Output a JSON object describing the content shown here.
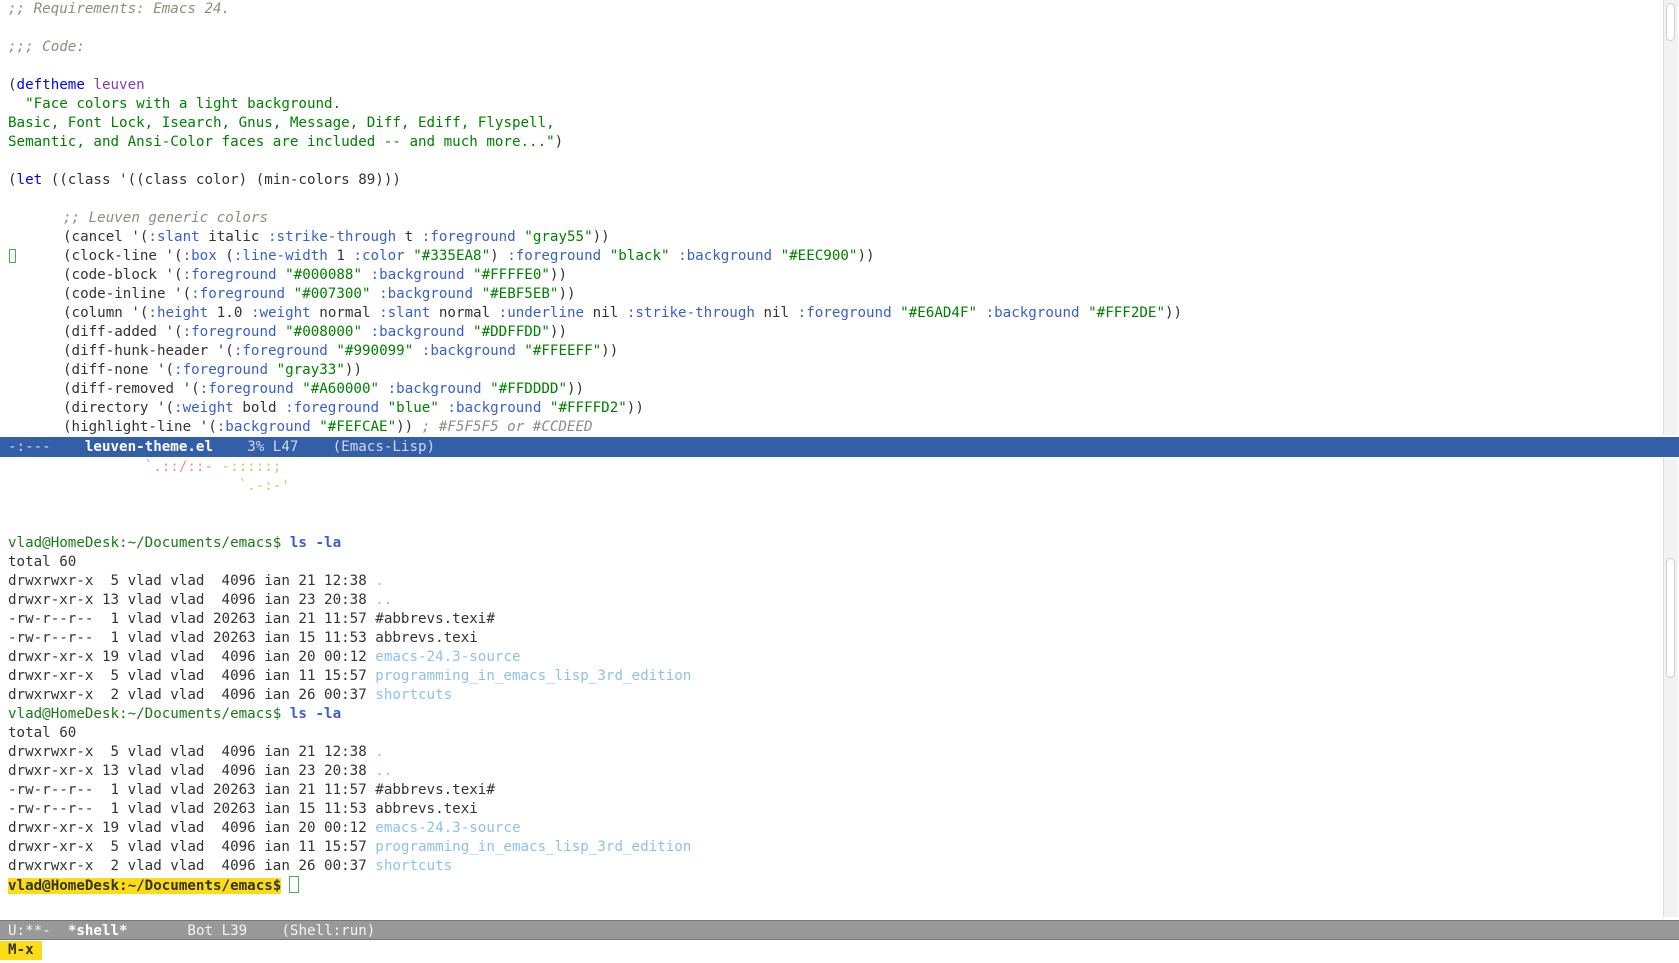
{
  "editor": {
    "lines": {
      "l0": ";; Requirements: Emacs 24.",
      "l1": ";;; Code:",
      "deftheme_open": "(",
      "deftheme_kw": "deftheme",
      "deftheme_name": "leuven",
      "doc1": "  \"Face colors with a light background.",
      "doc2": "Basic, Font Lock, Isearch, Gnus, Message, Diff, Ediff, Flyspell,",
      "doc3": "Semantic, and Ansi-Color faces are included -- and much more...\"",
      "doc3_close": ")",
      "let_open": "(",
      "let_kw": "let",
      "let_rest": " ((class '((class color) (min-colors 89)))",
      "generic_comment": ";; Leuven generic colors"
    },
    "code": [
      [
        [
          "(cancel '(",
          ""
        ],
        [
          ":slant",
          "key"
        ],
        [
          " italic ",
          ""
        ],
        [
          ":strike-through",
          "key"
        ],
        [
          " t ",
          ""
        ],
        [
          ":foreground",
          "key"
        ],
        [
          " ",
          ""
        ],
        [
          "\"gray55\"",
          "str"
        ],
        [
          "))",
          ""
        ]
      ],
      [
        [
          "(clock-line '(",
          ""
        ],
        [
          ":box",
          "key"
        ],
        [
          " (",
          ""
        ],
        [
          ":line-width",
          "key"
        ],
        [
          " 1 ",
          ""
        ],
        [
          ":color",
          "key"
        ],
        [
          " ",
          ""
        ],
        [
          "\"#335EA8\"",
          "str"
        ],
        [
          ") ",
          ""
        ],
        [
          ":foreground",
          "key"
        ],
        [
          " ",
          ""
        ],
        [
          "\"black\"",
          "str"
        ],
        [
          " ",
          ""
        ],
        [
          ":background",
          "key"
        ],
        [
          " ",
          ""
        ],
        [
          "\"#EEC900\"",
          "str"
        ],
        [
          "))",
          ""
        ]
      ],
      [
        [
          "(code-block '(",
          ""
        ],
        [
          ":foreground",
          "key"
        ],
        [
          " ",
          ""
        ],
        [
          "\"#000088\"",
          "str"
        ],
        [
          " ",
          ""
        ],
        [
          ":background",
          "key"
        ],
        [
          " ",
          ""
        ],
        [
          "\"#FFFFE0\"",
          "str"
        ],
        [
          "))",
          ""
        ]
      ],
      [
        [
          "(code-inline '(",
          ""
        ],
        [
          ":foreground",
          "key"
        ],
        [
          " ",
          ""
        ],
        [
          "\"#007300\"",
          "str"
        ],
        [
          " ",
          ""
        ],
        [
          ":background",
          "key"
        ],
        [
          " ",
          ""
        ],
        [
          "\"#EBF5EB\"",
          "str"
        ],
        [
          "))",
          ""
        ]
      ],
      [
        [
          "(column '(",
          ""
        ],
        [
          ":height",
          "key"
        ],
        [
          " 1.0 ",
          ""
        ],
        [
          ":weight",
          "key"
        ],
        [
          " normal ",
          ""
        ],
        [
          ":slant",
          "key"
        ],
        [
          " normal ",
          ""
        ],
        [
          ":underline",
          "key"
        ],
        [
          " nil ",
          ""
        ],
        [
          ":strike-through",
          "key"
        ],
        [
          " nil ",
          ""
        ],
        [
          ":foreground",
          "key"
        ],
        [
          " ",
          ""
        ],
        [
          "\"#E6AD4F\"",
          "str"
        ],
        [
          " ",
          ""
        ],
        [
          ":background",
          "key"
        ],
        [
          " ",
          ""
        ],
        [
          "\"#FFF2DE\"",
          "str"
        ],
        [
          "))",
          ""
        ]
      ],
      [
        [
          "(diff-added '(",
          ""
        ],
        [
          ":foreground",
          "key"
        ],
        [
          " ",
          ""
        ],
        [
          "\"#008000\"",
          "str"
        ],
        [
          " ",
          ""
        ],
        [
          ":background",
          "key"
        ],
        [
          " ",
          ""
        ],
        [
          "\"#DDFFDD\"",
          "str"
        ],
        [
          "))",
          ""
        ]
      ],
      [
        [
          "(diff-hunk-header '(",
          ""
        ],
        [
          ":foreground",
          "key"
        ],
        [
          " ",
          ""
        ],
        [
          "\"#990099\"",
          "str"
        ],
        [
          " ",
          ""
        ],
        [
          ":background",
          "key"
        ],
        [
          " ",
          ""
        ],
        [
          "\"#FFEEFF\"",
          "str"
        ],
        [
          "))",
          ""
        ]
      ],
      [
        [
          "(diff-none '(",
          ""
        ],
        [
          ":foreground",
          "key"
        ],
        [
          " ",
          ""
        ],
        [
          "\"gray33\"",
          "str"
        ],
        [
          "))",
          ""
        ]
      ],
      [
        [
          "(diff-removed '(",
          ""
        ],
        [
          ":foreground",
          "key"
        ],
        [
          " ",
          ""
        ],
        [
          "\"#A60000\"",
          "str"
        ],
        [
          " ",
          ""
        ],
        [
          ":background",
          "key"
        ],
        [
          " ",
          ""
        ],
        [
          "\"#FFDDDD\"",
          "str"
        ],
        [
          "))",
          ""
        ]
      ],
      [
        [
          "(directory '(",
          ""
        ],
        [
          ":weight",
          "key"
        ],
        [
          " bold ",
          ""
        ],
        [
          ":foreground",
          "key"
        ],
        [
          " ",
          ""
        ],
        [
          "\"blue\"",
          "str"
        ],
        [
          " ",
          ""
        ],
        [
          ":background",
          "key"
        ],
        [
          " ",
          ""
        ],
        [
          "\"#FFFFD2\"",
          "str"
        ],
        [
          "))",
          ""
        ]
      ],
      [
        [
          "(highlight-line '(",
          ""
        ],
        [
          ":background",
          "key"
        ],
        [
          " ",
          ""
        ],
        [
          "\"#FEFCAE\"",
          "str"
        ],
        [
          ")) ",
          ""
        ],
        [
          "; #F5F5F5 or #CCDEED",
          "cmt"
        ]
      ]
    ]
  },
  "modeline_editor": {
    "state": "-:---",
    "buffer": "leuven-theme.el",
    "position": "3% L47",
    "mode": "(Emacs-Lisp)"
  },
  "shell": {
    "ascii_line1_a": "`.::/::- ",
    "ascii_line1_b": "-:::::;",
    "ascii_line2": "`.-:-'",
    "prompt": "vlad@HomeDesk:~/Documents/emacs$",
    "command": "ls -la",
    "total": "total 60",
    "listing": [
      {
        "meta": "drwxrwxr-x  5 vlad vlad  4096 ian 21 12:38 ",
        "name": ".",
        "is_dir": true
      },
      {
        "meta": "drwxr-xr-x 13 vlad vlad  4096 ian 23 20:38 ",
        "name": "..",
        "is_dir": true
      },
      {
        "meta": "-rw-r--r--  1 vlad vlad 20263 ian 21 11:57 ",
        "name": "#abbrevs.texi#",
        "is_dir": false
      },
      {
        "meta": "-rw-r--r--  1 vlad vlad 20263 ian 15 11:53 ",
        "name": "abbrevs.texi",
        "is_dir": false
      },
      {
        "meta": "drwxr-xr-x 19 vlad vlad  4096 ian 20 00:12 ",
        "name": "emacs-24.3-source",
        "is_dir": true
      },
      {
        "meta": "drwxr-xr-x  5 vlad vlad  4096 ian 11 15:57 ",
        "name": "programming_in_emacs_lisp_3rd_edition",
        "is_dir": true
      },
      {
        "meta": "drwxrwxr-x  2 vlad vlad  4096 ian 26 00:37 ",
        "name": "shortcuts",
        "is_dir": true
      }
    ]
  },
  "modeline_shell": {
    "state": "U:**-",
    "buffer": "*shell*",
    "position": "Bot L39",
    "mode": "(Shell:run)"
  },
  "minibuffer": {
    "label": "M-x"
  }
}
